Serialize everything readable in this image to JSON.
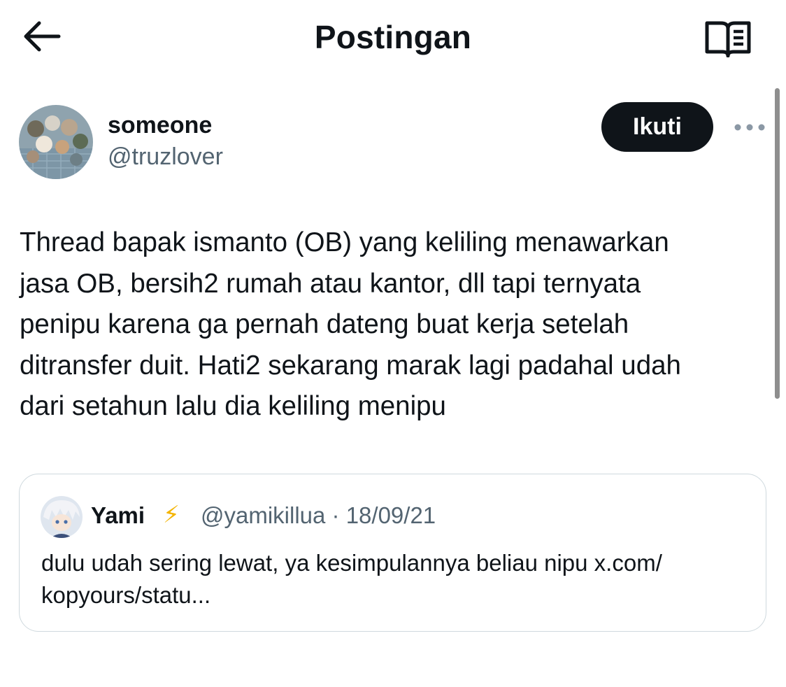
{
  "header": {
    "title": "Postingan",
    "back_icon": "arrow-left-icon",
    "reader_icon": "open-book-icon"
  },
  "post": {
    "author": {
      "display_name": "someone",
      "handle": "@truzlover"
    },
    "follow_label": "Ikuti",
    "more_icon": "more-dots-icon",
    "text": "Thread bapak ismanto (OB) yang keliling menawarkan\njasa OB, bersih2 rumah atau kantor, dll tapi ternyata\npenipu karena ga pernah dateng buat kerja setelah\nditransfer duit. Hati2 sekarang marak lagi padahal udah\ndari setahun lalu dia keliling menipu"
  },
  "quote": {
    "display_name": "Yami",
    "badge": "⚡",
    "handle": "@yamikillua",
    "separator": " · ",
    "date": "18/09/21",
    "text": "dulu udah sering lewat, ya kesimpulannya beliau nipu x.com/\nkopyours/statu..."
  },
  "colors": {
    "text_primary": "#0f1419",
    "text_secondary": "#536471",
    "border": "#cfd9de",
    "follow_bg": "#0f1419",
    "badge": "#f4b400"
  }
}
